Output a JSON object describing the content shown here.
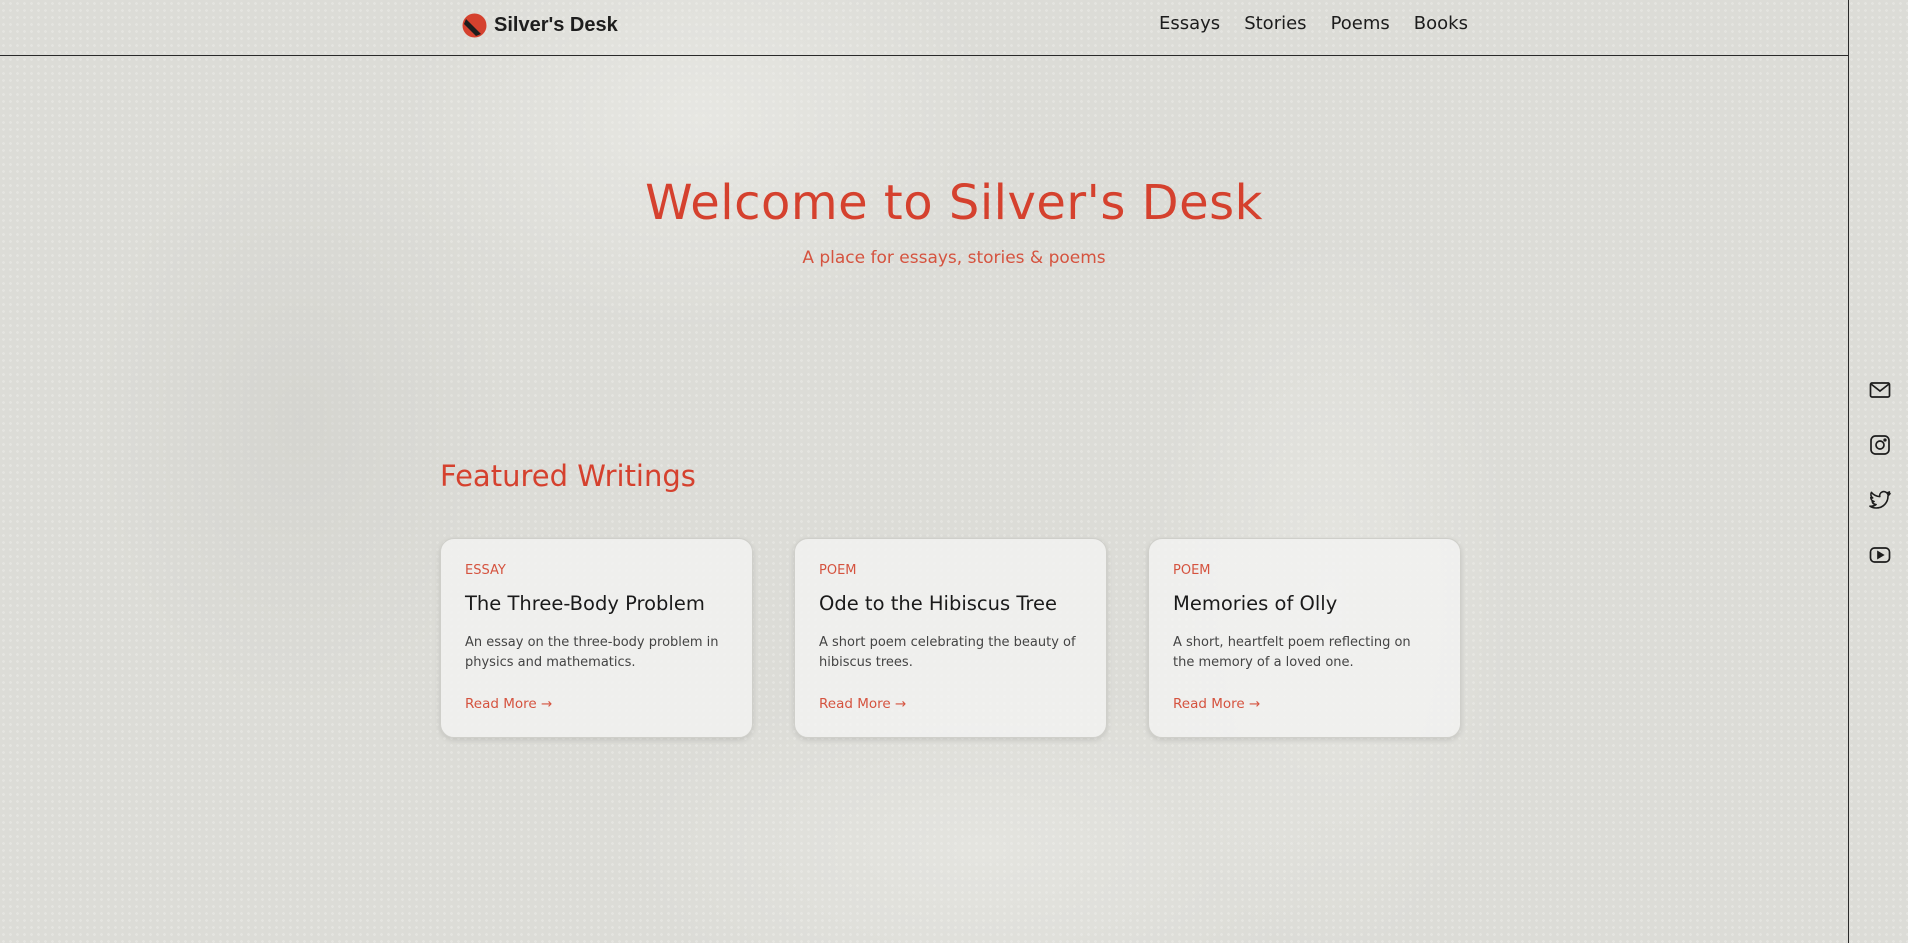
{
  "header": {
    "logo_text": "Silver's Desk",
    "nav": [
      "Essays",
      "Stories",
      "Poems",
      "Books"
    ]
  },
  "hero": {
    "title": "Welcome to Silver's Desk",
    "subtitle": "A place for essays, stories & poems"
  },
  "featured": {
    "title": "Featured Writings",
    "cards": [
      {
        "type": "ESSAY",
        "title": "The Three-Body Problem",
        "description": "An essay on the three-body problem in physics and mathematics.",
        "link": "Read More →"
      },
      {
        "type": "POEM",
        "title": "Ode to the Hibiscus Tree",
        "description": "A short poem celebrating the beauty of hibiscus trees.",
        "link": "Read More →"
      },
      {
        "type": "POEM",
        "title": "Memories of Olly",
        "description": "A short, heartfelt poem reflecting on the memory of a loved one.",
        "link": "Read More →"
      }
    ]
  },
  "socials": [
    "mail-icon",
    "instagram-icon",
    "twitter-icon",
    "youtube-icon"
  ],
  "colors": {
    "accent": "#d5412e",
    "background": "#dcdcd7",
    "text": "#1a1a1a"
  }
}
